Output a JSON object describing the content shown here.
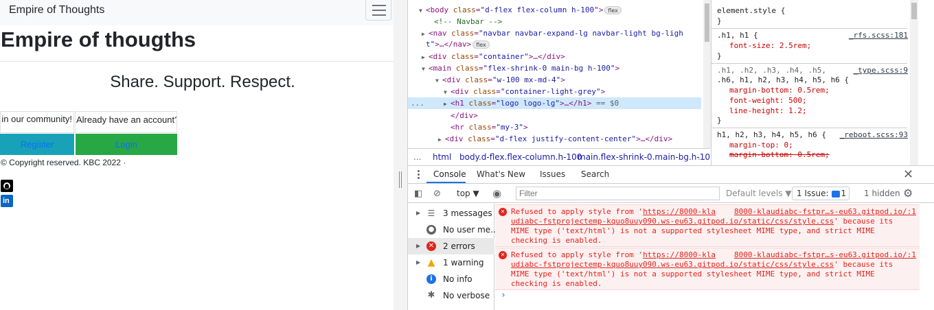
{
  "preview": {
    "brand": "Empire of Thoughts",
    "logo": "Empire of thougths",
    "tagline": "Share. Support. Respect.",
    "card_join": "in our community!",
    "card_account": "Already have an account?",
    "register_label": "Register",
    "login_label": "Login",
    "footer": "© Copyright reserved. KBC 2022 ·",
    "linkedin_glyph": "in",
    "colors": {
      "register": "#17a2b8",
      "login": "#28a745",
      "link": "#0d6efd"
    }
  },
  "elements": {
    "lines": [
      {
        "tri": "▼",
        "p1": "<body ",
        "a1": "class",
        "v1": "\"d-flex flex-column h-100\"",
        "p2": ">",
        "badge": "flex"
      },
      {
        "cmt": "<!-- Navbar -->"
      },
      {
        "tri": "▶",
        "p1": "<nav ",
        "a1": "class",
        "v1": "\"navbar navbar-expand-lg navbar-light bg-ligh"
      },
      {
        "v1": "t\"",
        "p2": ">…</nav>",
        "badge": "flex"
      },
      {
        "tri": "▶",
        "p1": "<div ",
        "a1": "class",
        "v1": "\"container\"",
        "p2": ">…</div>"
      },
      {
        "tri": "▼",
        "p1": "<main ",
        "a1": "class",
        "v1": "\"flex-shrink-0 main-bg h-100\"",
        "p2": ">"
      },
      {
        "tri": "▼",
        "p1": "<div ",
        "a1": "class",
        "v1": "\"w-100 mx-md-4\"",
        "p2": ">"
      },
      {
        "tri": "▼",
        "p1": "<div ",
        "a1": "class",
        "v1": "\"container-light-grey\"",
        "p2": ">"
      },
      {
        "tri": "▶",
        "p1": "<h1 ",
        "a1": "class",
        "v1": "\"logo logo-lg\"",
        "p2": ">…</h1>",
        "eq0": " == $0",
        "gutter": "..."
      },
      {
        "p1": "</div>"
      },
      {
        "p1": "<hr ",
        "a1": "class",
        "v1": "\"my-3\"",
        "p2": ">"
      },
      {
        "tri": "▶",
        "p1": "<div ",
        "a1": "class",
        "v1": "\"d-flex justify-content-center\"",
        "p2": ">…</div>"
      }
    ]
  },
  "breadcrumbs": {
    "ellipsis_left": "...",
    "items": [
      "html",
      "body.d-flex.flex-column.h-100",
      "main.flex-shrink-0.main-bg.h-10"
    ],
    "ellipsis_right": "..."
  },
  "styles": {
    "element_style": "element.style {",
    "close": "}",
    "rule1": {
      "selector": ".h1, h1 {",
      "file": "_rfs.scss:181",
      "props": [
        "font-size: 2.5rem;"
      ]
    },
    "rule2": {
      "selector1": ".h1, .h2, .h3, .h4, .h5,",
      "selector2": ".h6, h1, h2, h3, h4, h5, h6 {",
      "file": "_type.scss:9",
      "props": [
        "margin-bottom: 0.5rem;",
        "font-weight: 500;",
        "line-height: 1.2;"
      ]
    },
    "rule3": {
      "selector": "h1, h2, h3, h4, h5, h6 {",
      "file": "_reboot.scss:93",
      "props": [
        "margin-top: 0;",
        "margin-bottom: 0.5rem;"
      ]
    }
  },
  "drawer": {
    "tabs": [
      "Console",
      "What's New",
      "Issues",
      "Search"
    ],
    "close": "✕",
    "context": "top ▼",
    "filter_placeholder": "Filter",
    "levels": "Default levels ▼",
    "issue_pre": "1 Issue:",
    "issue_count": "1",
    "hidden": "1 hidden",
    "sidebar": [
      {
        "tri": "▶",
        "label": "3 messages"
      },
      {
        "tri": "",
        "label": "No user me..."
      },
      {
        "tri": "▶",
        "label": "2 errors"
      },
      {
        "tri": "▶",
        "label": "1 warning"
      },
      {
        "tri": "",
        "label": "No info"
      },
      {
        "tri": "",
        "label": "No verbose"
      }
    ],
    "messages": [
      {
        "l1a": "Refused to apply style from '",
        "l1b": "https://8000-kla",
        "l1c": "8000-klaudiabc-fstpr…s-eu63.gitpod.io/:1",
        "l2a": "udiabc-fstprojectemp-kquo8uuy090.ws-eu63.gitpod.io/static/css/style.css",
        "l2b": "' because its",
        "l3": "MIME type ('text/html') is not a supported stylesheet MIME type, and strict MIME",
        "l4": "checking is enabled."
      },
      {
        "l1a": "Refused to apply style from '",
        "l1b": "https://8000-kla",
        "l1c": "8000-klaudiabc-fstpr…s-eu63.gitpod.io/:1",
        "l2a": "udiabc-fstprojectemp-kquo8uuy090.ws-eu63.gitpod.io/static/css/style.css",
        "l2b": "' because its",
        "l3": "MIME type ('text/html') is not a supported stylesheet MIME type, and strict MIME",
        "l4": "checking is enabled."
      }
    ],
    "prompt": "›"
  }
}
